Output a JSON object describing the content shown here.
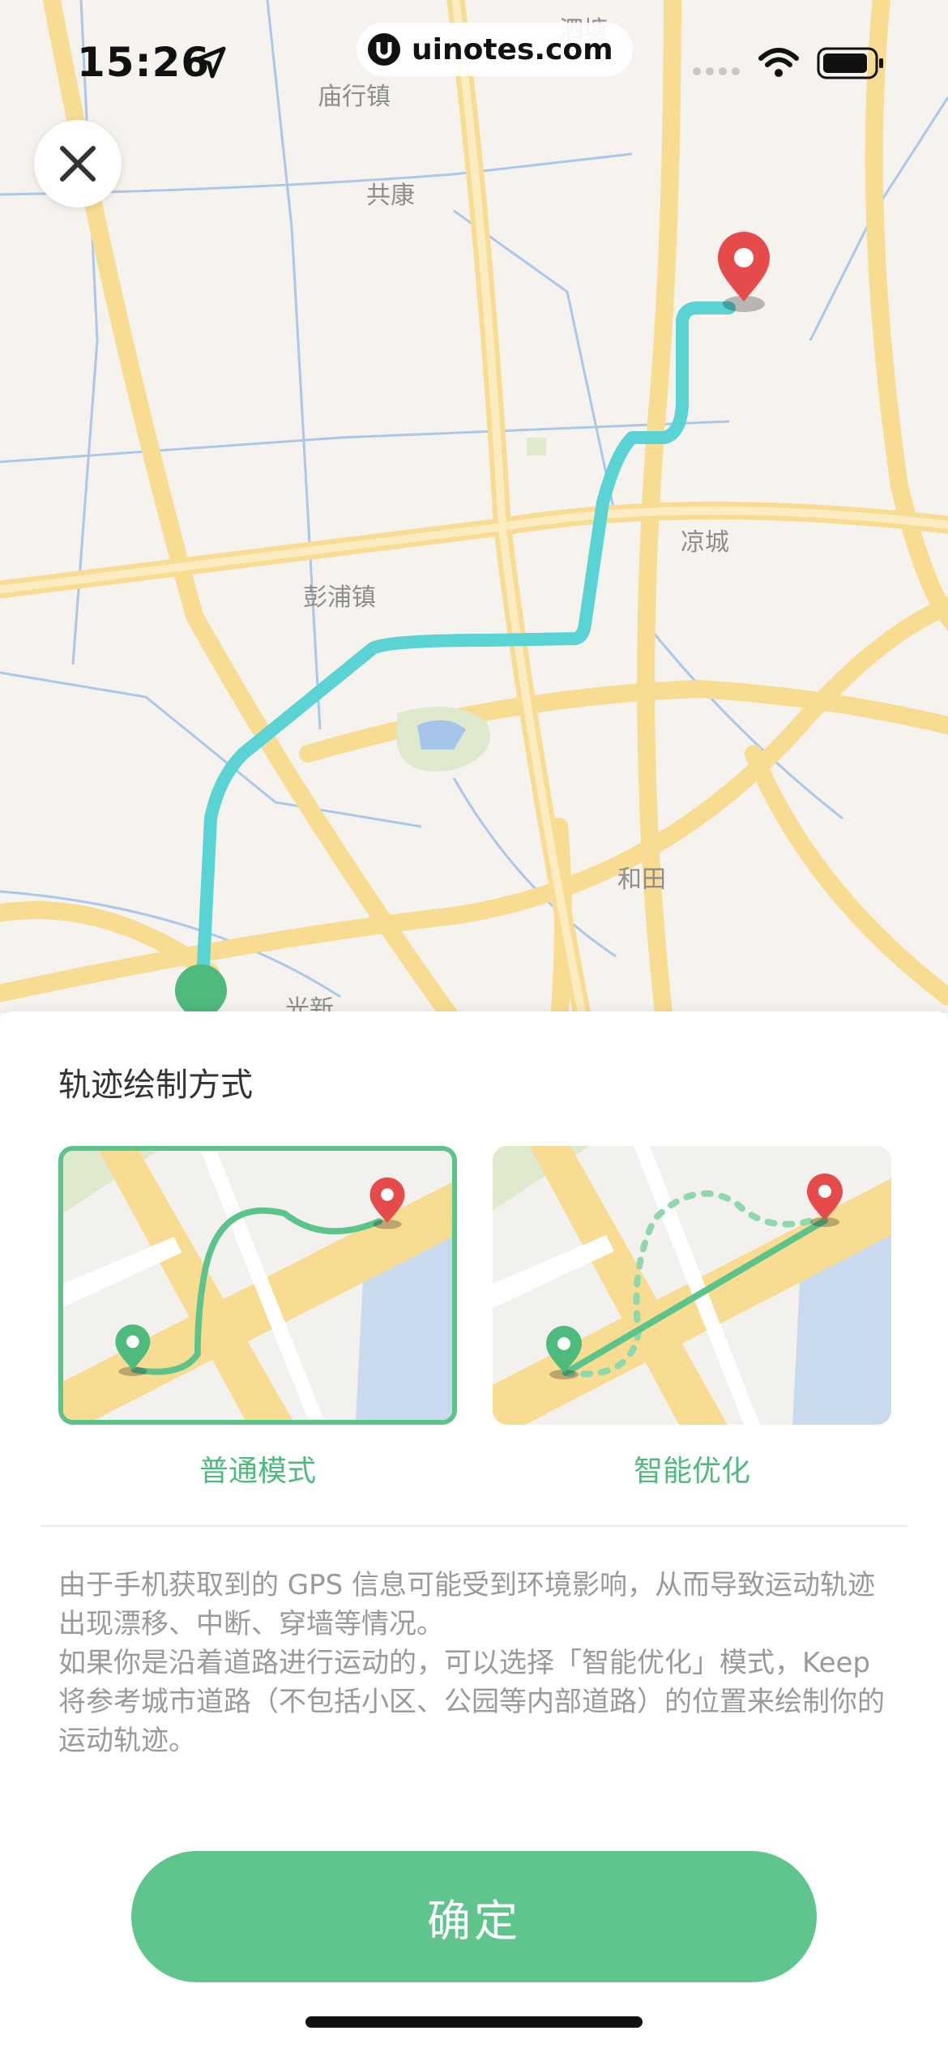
{
  "status_bar": {
    "time": "15:26",
    "url": "uinotes.com"
  },
  "map": {
    "labels": [
      "庙行镇",
      "共康",
      "彭浦镇",
      "凉城",
      "和田",
      "光新",
      "泗塘"
    ]
  },
  "sheet": {
    "title": "轨迹绘制方式",
    "modes": [
      {
        "label": "普通模式",
        "selected": true
      },
      {
        "label": "智能优化",
        "selected": false
      }
    ],
    "description": [
      "由于手机获取到的 GPS 信息可能受到环境影响，从而导致运动轨迹出现漂移、中断、穿墙等情况。",
      "如果你是沿着道路进行运动的，可以选择「智能优化」模式，Keep 将参考城市道路（不包括小区、公园等内部道路）的位置来绘制你的运动轨迹。"
    ],
    "confirm_label": "确定"
  },
  "colors": {
    "accent": "#5fc58c",
    "route": "#5ad3d4",
    "pin_end": "#e54b4b",
    "pin_start": "#4fba7e"
  },
  "icons": {
    "close": "close-icon",
    "navigation": "location-arrow-icon",
    "wifi": "wifi-icon",
    "battery": "battery-icon"
  }
}
